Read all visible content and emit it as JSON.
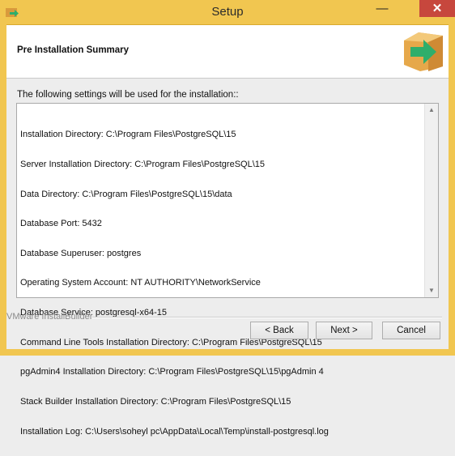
{
  "window": {
    "title": "Setup",
    "minimize_glyph": "—",
    "close_glyph": "✕"
  },
  "header": {
    "title": "Pre Installation Summary",
    "logo_icon": "installer-box-arrow-icon"
  },
  "intro_text": "The following settings will be used for the installation::",
  "summary_lines": [
    "Installation Directory: C:\\Program Files\\PostgreSQL\\15",
    "Server Installation Directory: C:\\Program Files\\PostgreSQL\\15",
    "Data Directory: C:\\Program Files\\PostgreSQL\\15\\data",
    "Database Port: 5432",
    "Database Superuser: postgres",
    "Operating System Account: NT AUTHORITY\\NetworkService",
    "Database Service: postgresql-x64-15",
    "Command Line Tools Installation Directory: C:\\Program Files\\PostgreSQL\\15",
    "pgAdmin4 Installation Directory: C:\\Program Files\\PostgreSQL\\15\\pgAdmin 4",
    "Stack Builder Installation Directory: C:\\Program Files\\PostgreSQL\\15",
    "Installation Log: C:\\Users\\soheyl pc\\AppData\\Local\\Temp\\install-postgresql.log"
  ],
  "vendor": "VMware InstallBuilder",
  "buttons": {
    "back": "< Back",
    "next": "Next >",
    "cancel": "Cancel"
  },
  "colors": {
    "titlebar": "#f1c650",
    "close_button": "#c7473d",
    "logo_box": "#e6a84a",
    "logo_arrow": "#2fae6b"
  }
}
